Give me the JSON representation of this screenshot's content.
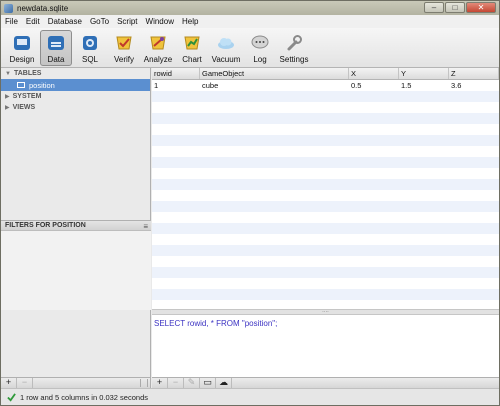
{
  "window": {
    "title": "newdata.sqlite"
  },
  "menu": [
    "File",
    "Edit",
    "Database",
    "GoTo",
    "Script",
    "Window",
    "Help"
  ],
  "toolbar": {
    "buttons": [
      "Design",
      "Data",
      "SQL",
      "Verify",
      "Analyze",
      "Chart",
      "Vacuum",
      "Log",
      "Settings"
    ],
    "active": "Data"
  },
  "sidebar": {
    "tables_header": "TABLES",
    "selected_table": "position",
    "system_header": "SYSTEM",
    "views_header": "VIEWS"
  },
  "filters": {
    "title": "FILTERS FOR POSITION"
  },
  "grid": {
    "columns": [
      "rowid",
      "GameObject",
      "X",
      "Y",
      "Z"
    ],
    "rows": [
      [
        "1",
        "cube",
        "0.5",
        "1.5",
        "3.6"
      ]
    ]
  },
  "sql": {
    "query": "SELECT rowid, * FROM \"position\";"
  },
  "bottom": {
    "add": "+",
    "remove": "−"
  },
  "status": {
    "text": "1 row and 5 columns in 0.032 seconds"
  }
}
